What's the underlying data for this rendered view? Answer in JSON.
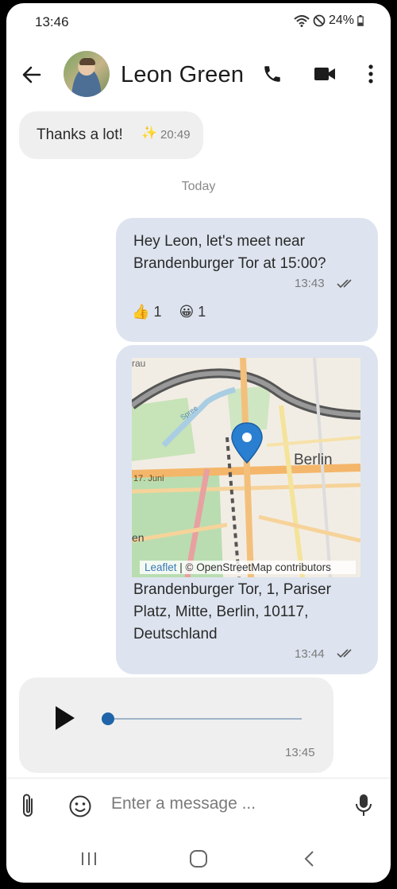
{
  "status": {
    "time": "13:46",
    "battery": "24%"
  },
  "header": {
    "contact_name": "Leon Green"
  },
  "messages": {
    "first": {
      "text": "Thanks a lot!",
      "emoji": "✨",
      "time": "20:49"
    },
    "day_separator": "Today",
    "meet": {
      "line1": "Hey Leon, let's meet near",
      "line2": "Brandenburger Tor at 15:00?",
      "time": "13:43",
      "reactions": [
        {
          "emoji": "👍",
          "count": "1"
        },
        {
          "emoji": "😀",
          "count": "1"
        }
      ]
    },
    "location": {
      "map_labels": {
        "city": "Berlin",
        "street": "17. Juni",
        "corner_top": "rau",
        "corner_left": "en",
        "river": "Spree"
      },
      "attribution_leaflet": "Leaflet",
      "attribution_sep": " | © ",
      "attribution_osm": "OpenStreetMap contributors",
      "address_line1": "Brandenburger Tor, 1, Pariser",
      "address_line2": "Platz, Mitte, Berlin, 10117,",
      "address_line3": "Deutschland",
      "time": "13:44"
    },
    "audio": {
      "time": "13:45",
      "progress": 0.0
    }
  },
  "composer": {
    "placeholder": "Enter a message ..."
  },
  "icons": {
    "back": "arrow-left-icon",
    "call": "phone-icon",
    "video": "video-camera-icon",
    "menu": "more-vertical-icon",
    "attach": "paperclip-icon",
    "emoji": "smiley-icon",
    "mic": "microphone-icon"
  },
  "colors": {
    "outgoing_bubble": "#dde4ef",
    "incoming_bubble": "#efefef",
    "accent": "#1f64a8",
    "map_pin": "#2b7fd0"
  }
}
